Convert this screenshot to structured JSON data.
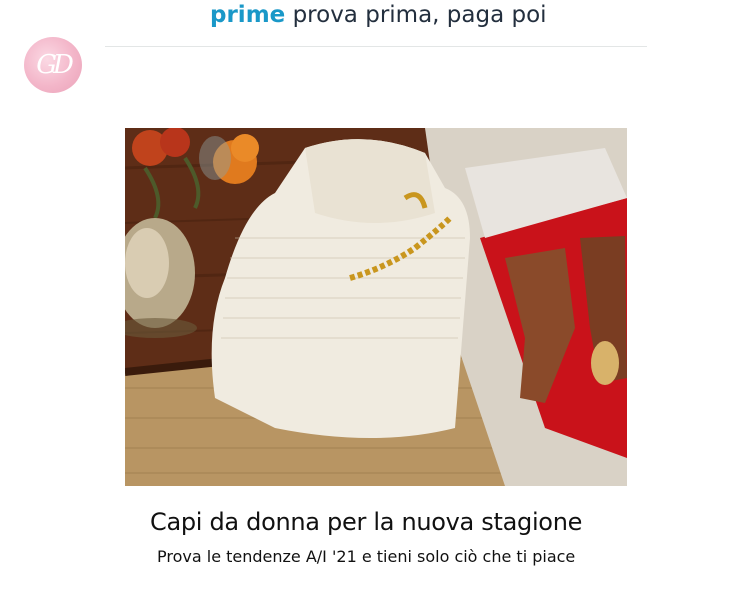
{
  "header": {
    "brand_word": "prime",
    "tagline": "prova prima, paga poi"
  },
  "logo": {
    "letters": "GD"
  },
  "hero": {
    "icon": "folded-sweater-photo"
  },
  "caption": {
    "title": "Capi da donna per la nuova stagione",
    "subtitle": "Prova le tendenze A/I '21 e tieni solo ciò che ti piace"
  },
  "colors": {
    "prime_blue": "#1a98c8",
    "text_dark": "#232f3e",
    "logo_pink": "#f3b6c9"
  }
}
